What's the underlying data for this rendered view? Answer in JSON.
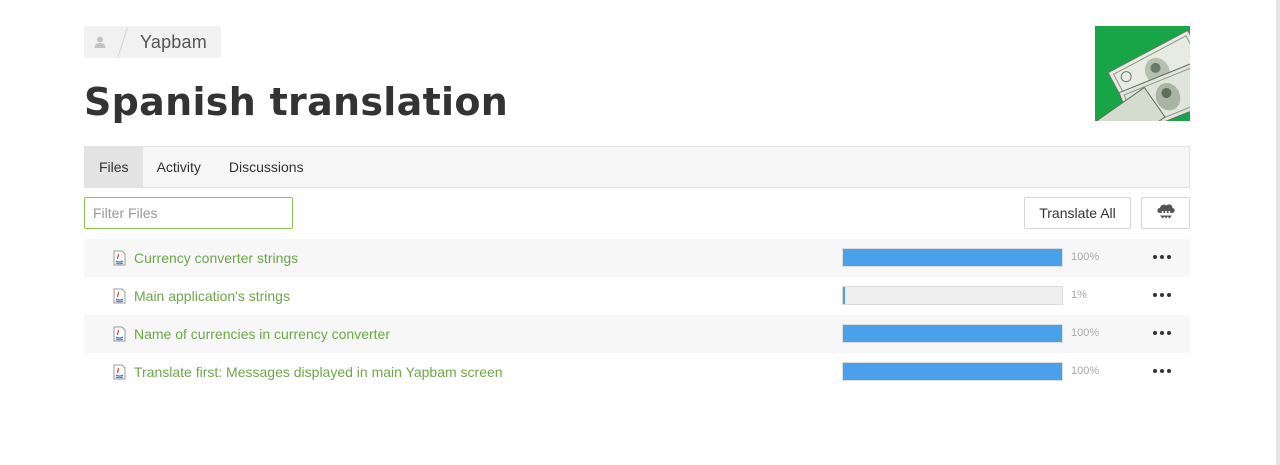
{
  "breadcrumb": {
    "project": "Yapbam"
  },
  "page": {
    "title": "Spanish translation"
  },
  "tabs": [
    {
      "label": "Files",
      "active": true
    },
    {
      "label": "Activity",
      "active": false
    },
    {
      "label": "Discussions",
      "active": false
    }
  ],
  "toolbar": {
    "filter_placeholder": "Filter Files",
    "translate_all_label": "Translate All",
    "download_icon": "cloud-download-icon"
  },
  "files": [
    {
      "name": "Currency converter strings",
      "progress": 100,
      "progress_label": "100%"
    },
    {
      "name": "Main application's strings",
      "progress": 1,
      "progress_label": "1%"
    },
    {
      "name": "Name of currencies in currency converter",
      "progress": 100,
      "progress_label": "100%"
    },
    {
      "name": "Translate first: Messages displayed in main Yapbam screen",
      "progress": 100,
      "progress_label": "100%"
    }
  ],
  "colors": {
    "link_green": "#6ea74a",
    "progress_blue": "#4aa0ea",
    "input_border_green": "#8bc34a"
  }
}
